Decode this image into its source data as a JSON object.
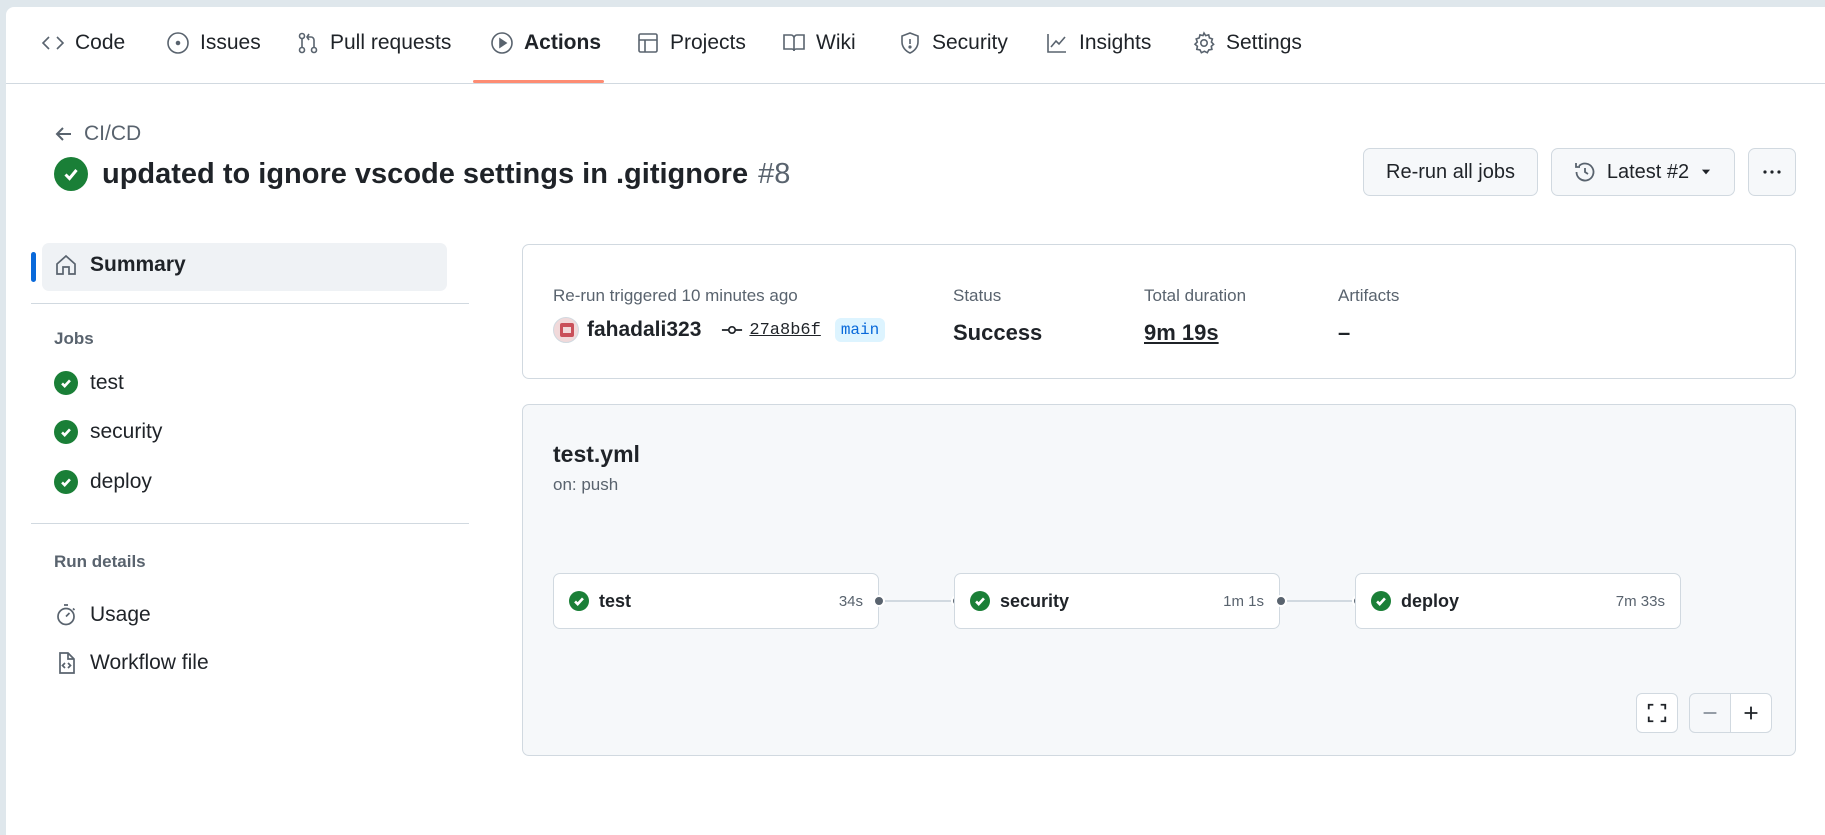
{
  "nav": {
    "tabs": [
      {
        "label": "Code",
        "icon": "code-icon"
      },
      {
        "label": "Issues",
        "icon": "issue-opened-icon"
      },
      {
        "label": "Pull requests",
        "icon": "git-pull-request-icon"
      },
      {
        "label": "Actions",
        "icon": "play-icon",
        "active": true
      },
      {
        "label": "Projects",
        "icon": "table-icon"
      },
      {
        "label": "Wiki",
        "icon": "book-icon"
      },
      {
        "label": "Security",
        "icon": "shield-icon"
      },
      {
        "label": "Insights",
        "icon": "graph-icon"
      },
      {
        "label": "Settings",
        "icon": "gear-icon"
      }
    ]
  },
  "header": {
    "back_label": "CI/CD",
    "title": "updated to ignore vscode settings in .gitignore",
    "run_number": "#8",
    "rerun_label": "Re-run all jobs",
    "attempt_label": "Latest #2"
  },
  "sidebar": {
    "summary_label": "Summary",
    "jobs_heading": "Jobs",
    "jobs": [
      "test",
      "security",
      "deploy"
    ],
    "run_details_heading": "Run details",
    "usage_label": "Usage",
    "workflow_file_label": "Workflow file"
  },
  "summary": {
    "trigger_text": "Re-run triggered 10 minutes ago",
    "actor": "fahadali323",
    "commit_sha": "27a8b6f",
    "branch": "main",
    "status_label": "Status",
    "status_value": "Success",
    "duration_label": "Total duration",
    "duration_value": "9m 19s",
    "artifacts_label": "Artifacts",
    "artifacts_value": "–"
  },
  "graph": {
    "workflow_file": "test.yml",
    "trigger": "on: push",
    "jobs": [
      {
        "name": "test",
        "duration": "34s"
      },
      {
        "name": "security",
        "duration": "1m 1s"
      },
      {
        "name": "deploy",
        "duration": "7m 33s"
      }
    ]
  },
  "colors": {
    "success": "#1a7f37",
    "accent": "#0969da",
    "tab_underline": "#fd8c73"
  }
}
